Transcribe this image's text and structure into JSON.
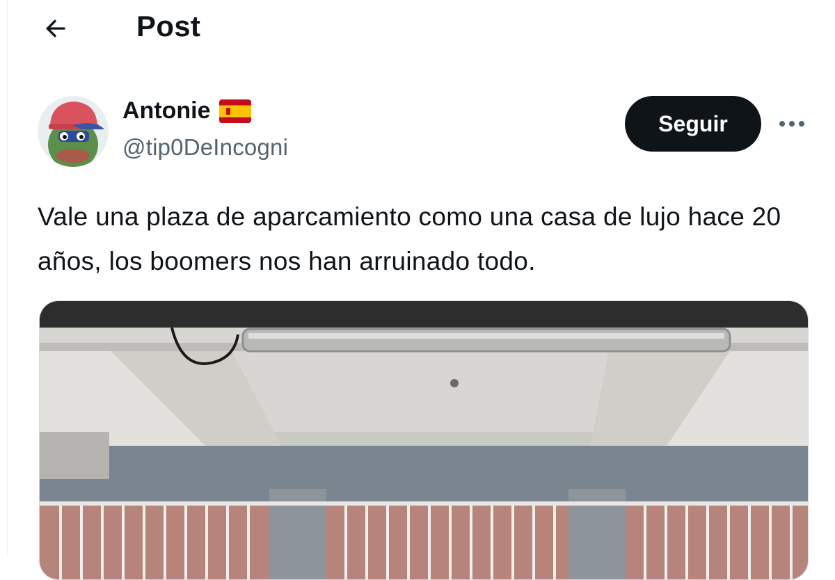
{
  "header": {
    "title": "Post",
    "back_icon": "arrow-left-icon"
  },
  "author": {
    "display_name": "Antonie",
    "flag_icon": "spain-flag-icon",
    "handle": "@tip0DeIncogni",
    "avatar_icon": "pepe-frog-avatar"
  },
  "actions": {
    "follow_label": "Seguir",
    "more_icon": "more-horizontal-icon"
  },
  "post": {
    "text": "Vale una plaza de aparcamiento como una casa de lujo hace 20 años, los boomers nos han arruinado todo."
  },
  "media": {
    "type": "photo",
    "subject": "parking-garage-photo"
  },
  "colors": {
    "text_primary": "#0f1419",
    "text_secondary": "#536471",
    "button_bg": "#0f1419",
    "button_text": "#ffffff",
    "divider": "#eff3f4"
  }
}
